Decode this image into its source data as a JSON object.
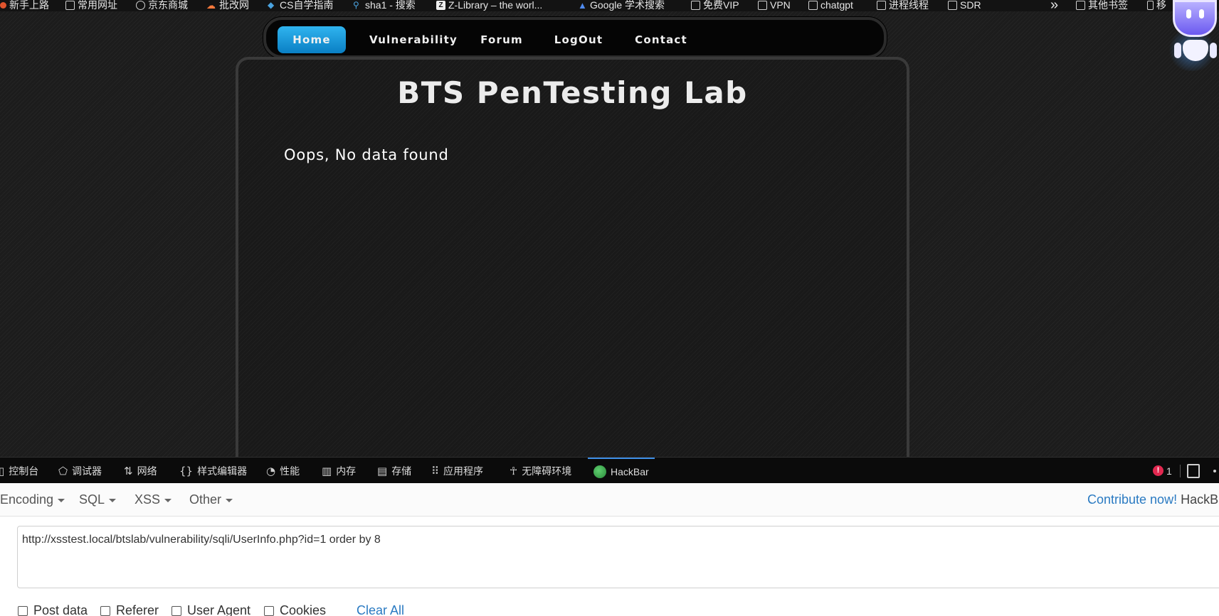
{
  "bookmarks": [
    {
      "label": "新手上路",
      "icon": "orange-dot-icon"
    },
    {
      "label": "常用网址",
      "icon": "folder-icon"
    },
    {
      "label": "京东商城",
      "icon": "globe-icon"
    },
    {
      "label": "批改网",
      "icon": "cloud-icon"
    },
    {
      "label": "CS自学指南",
      "icon": "cube-icon"
    },
    {
      "label": "sha1 - 搜索",
      "icon": "search-icon"
    },
    {
      "label": "Z-Library – the worl...",
      "icon": "zlibrary-icon"
    },
    {
      "label": "Google 学术搜索",
      "icon": "scholar-icon"
    },
    {
      "label": "免费VIP",
      "icon": "folder-icon"
    },
    {
      "label": "VPN",
      "icon": "folder-icon"
    },
    {
      "label": "chatgpt",
      "icon": "folder-icon"
    },
    {
      "label": "进程线程",
      "icon": "folder-icon"
    },
    {
      "label": "SDR",
      "icon": "folder-icon"
    },
    {
      "label": "其他书签",
      "icon": "folder-icon"
    },
    {
      "label": "移",
      "icon": "mobile-icon"
    }
  ],
  "overflow_glyph": "»",
  "nav": {
    "items": [
      "Home",
      "Vulnerability",
      "Forum",
      "LogOut",
      "Contact"
    ],
    "active": "Home"
  },
  "lab": {
    "title": "BTS PenTesting Lab",
    "message": "Oops, No data found"
  },
  "devtools": {
    "tabs": [
      {
        "label": "控制台",
        "icon": "console-icon"
      },
      {
        "label": "调试器",
        "icon": "debugger-icon"
      },
      {
        "label": "网络",
        "icon": "network-icon"
      },
      {
        "label": "样式编辑器",
        "icon": "style-editor-icon"
      },
      {
        "label": "性能",
        "icon": "performance-icon"
      },
      {
        "label": "内存",
        "icon": "memory-icon"
      },
      {
        "label": "存储",
        "icon": "storage-icon"
      },
      {
        "label": "应用程序",
        "icon": "application-icon"
      },
      {
        "label": "无障碍环境",
        "icon": "accessibility-icon"
      },
      {
        "label": "HackBar",
        "icon": "hackbar-icon"
      }
    ],
    "active_tab": "HackBar",
    "error_count": "1"
  },
  "hackbar": {
    "menus": [
      "Encoding",
      "SQL",
      "XSS",
      "Other"
    ],
    "contribute_link": "Contribute now!",
    "contribute_suffix": "HackBa",
    "url": "http://xsstest.local/btslab/vulnerability/sqli/UserInfo.php?id=1 order by 8",
    "options": [
      "Post data",
      "Referer",
      "User Agent",
      "Cookies"
    ],
    "clear_all": "Clear All"
  },
  "colors": {
    "nav_active": "#1a9ad9",
    "link": "#2a7ac2",
    "error": "#e22850",
    "devtools_active": "#3d8ee6"
  }
}
